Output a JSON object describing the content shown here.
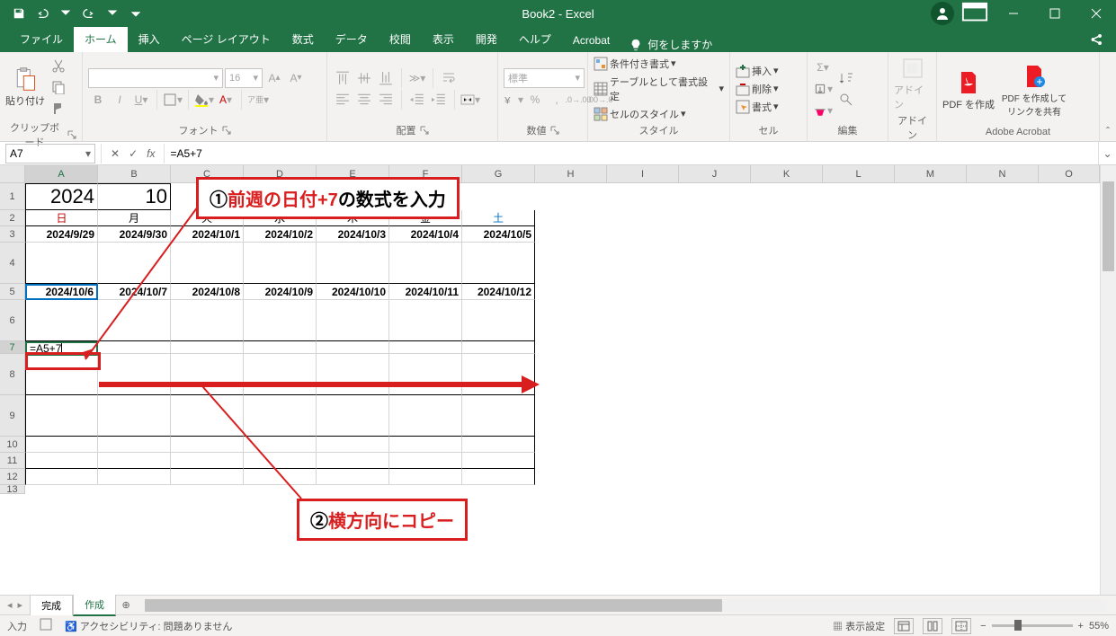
{
  "titlebar": {
    "title": "Book2 - Excel"
  },
  "tabs": {
    "file": "ファイル",
    "home": "ホーム",
    "insert": "挿入",
    "pagelayout": "ページ レイアウト",
    "formulas": "数式",
    "data": "データ",
    "review": "校閲",
    "view": "表示",
    "developer": "開発",
    "help": "ヘルプ",
    "acrobat": "Acrobat",
    "tellme": "何をしますか"
  },
  "ribbon": {
    "clipboard": {
      "paste": "貼り付け",
      "label": "クリップボード"
    },
    "font": {
      "label": "フォント",
      "size": "16"
    },
    "alignment": {
      "label": "配置"
    },
    "number": {
      "label": "数値",
      "format": "標準"
    },
    "styles": {
      "label": "スタイル",
      "conditional": "条件付き書式",
      "table": "テーブルとして書式設定",
      "cell": "セルのスタイル"
    },
    "cells": {
      "label": "セル",
      "insert": "挿入",
      "delete": "削除",
      "format": "書式"
    },
    "editing": {
      "label": "編集"
    },
    "addin": {
      "label": "アドイン",
      "btn": "アドイン"
    },
    "acrobat": {
      "label": "Adobe Acrobat",
      "pdf1": "PDF を作成",
      "pdf2": "PDF を作成してリンクを共有"
    }
  },
  "formula_bar": {
    "cell_ref": "A7",
    "formula": "=A5+7"
  },
  "columns": [
    "A",
    "B",
    "C",
    "D",
    "E",
    "F",
    "G",
    "H",
    "I",
    "J",
    "K",
    "L",
    "M",
    "N",
    "O"
  ],
  "row_heights": {
    "r1": 30,
    "r2": 18,
    "r3": 18,
    "r4": 46,
    "r5": 18,
    "r6": 46,
    "r7": 14,
    "r8": 46,
    "r9": 46,
    "r10": 18,
    "r11": 18,
    "r12": 18,
    "r13": 10
  },
  "col_widths": {
    "data": 81,
    "rest": 80
  },
  "sheet": {
    "r1": {
      "a": "2024",
      "b": "10"
    },
    "r2": {
      "a": "日",
      "b": "月",
      "c": "火",
      "d": "水",
      "e": "木",
      "f": "金",
      "g": "土"
    },
    "r3": {
      "a": "2024/9/29",
      "b": "2024/9/30",
      "c": "2024/10/1",
      "d": "2024/10/2",
      "e": "2024/10/3",
      "f": "2024/10/4",
      "g": "2024/10/5"
    },
    "r5": {
      "a": "2024/10/6",
      "b": "2024/10/7",
      "c": "2024/10/8",
      "d": "2024/10/9",
      "e": "2024/10/10",
      "f": "2024/10/11",
      "g": "2024/10/12"
    },
    "r7": {
      "a": "=A5+7"
    }
  },
  "annotations": {
    "box1_prefix": "①",
    "box1_red": "前週の日付+7",
    "box1_rest": "の数式を入力",
    "box2_prefix": "②",
    "box2_text": "横方向にコピー"
  },
  "sheettabs": {
    "tab1": "完成",
    "tab2": "作成"
  },
  "status": {
    "mode": "入力",
    "accessibility": "アクセシビリティ: 問題ありません",
    "display": "表示設定",
    "zoom": "55%"
  }
}
